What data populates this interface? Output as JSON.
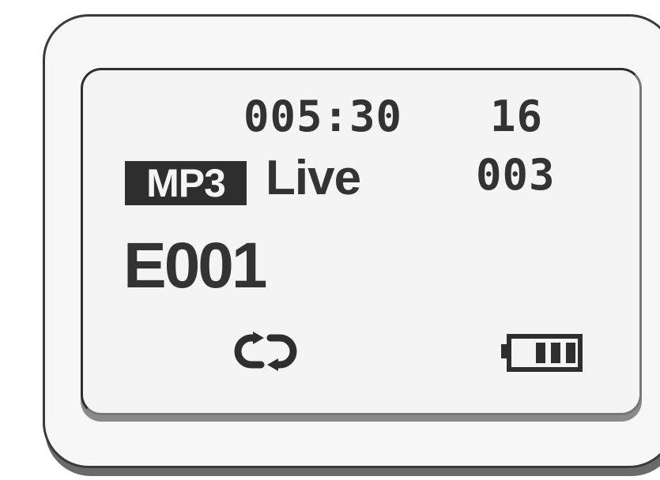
{
  "display": {
    "time": "005:30",
    "volume": "16",
    "format": "MP3",
    "eq_mode": "Live",
    "track_number": "003",
    "file_name": "E001"
  },
  "indicators": {
    "repeat_icon": "repeat-icon",
    "battery_icon": "battery-icon",
    "battery_level": 0.75
  },
  "colors": {
    "lcd_background": "#f4f4f4",
    "segment": "#333333",
    "bezel": "#f7f7f7"
  }
}
